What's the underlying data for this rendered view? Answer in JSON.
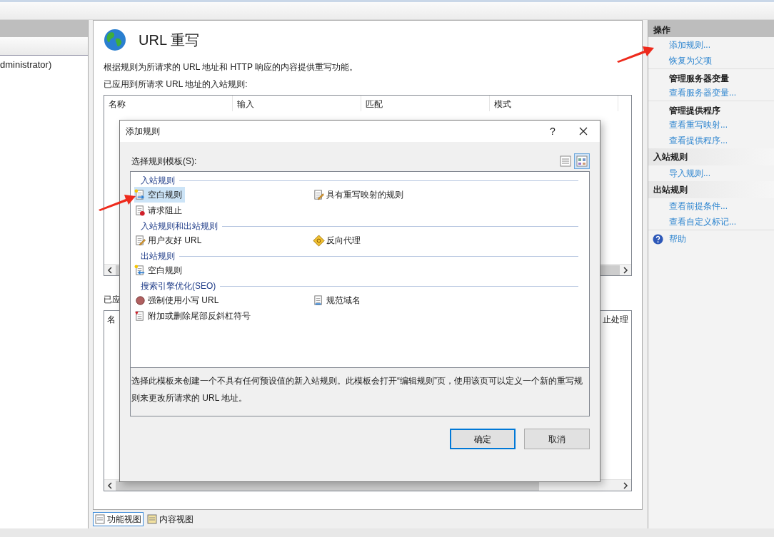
{
  "left_panel": {
    "tree_items": [
      "dministrator)"
    ]
  },
  "feature": {
    "title": "URL 重写",
    "description": "根据规则为所请求的 URL 地址和 HTTP 响应的内容提供重写功能。",
    "inbound_label": "已应用到所请求 URL 地址的入站规则:",
    "inbound_table": {
      "columns": [
        "名称",
        "输入",
        "匹配",
        "模式"
      ]
    },
    "outbound_label": "已应",
    "outbound_table": {
      "columns": [
        "名",
        "止处理"
      ]
    }
  },
  "view_tabs": [
    {
      "label": "功能视图",
      "selected": true
    },
    {
      "label": "内容视图",
      "selected": false
    }
  ],
  "actions": {
    "title": "操作",
    "items": [
      {
        "kind": "link",
        "label": "添加规则..."
      },
      {
        "kind": "link",
        "label": "恢复为父项"
      },
      {
        "kind": "heading",
        "label": "管理服务器变量"
      },
      {
        "kind": "link",
        "label": "查看服务器变量..."
      },
      {
        "kind": "heading",
        "label": "管理提供程序"
      },
      {
        "kind": "link",
        "label": "查看重写映射..."
      },
      {
        "kind": "link",
        "label": "查看提供程序..."
      },
      {
        "kind": "section",
        "label": "入站规则"
      },
      {
        "kind": "link",
        "label": "导入规则..."
      },
      {
        "kind": "section",
        "label": "出站规则"
      },
      {
        "kind": "link",
        "label": "查看前提条件..."
      },
      {
        "kind": "link",
        "label": "查看自定义标记..."
      },
      {
        "kind": "help",
        "label": "帮助"
      }
    ]
  },
  "dialog": {
    "title": "添加规则",
    "help": "?",
    "template_label": "选择规则模板(S):",
    "view_modes": [
      {
        "kind": "list",
        "selected": false
      },
      {
        "kind": "tiles",
        "selected": true
      }
    ],
    "groups": [
      {
        "title": "入站规则",
        "items": [
          {
            "kind": "new-inbound",
            "label": "空白规则",
            "selected": true
          },
          {
            "kind": "edit",
            "label": "具有重写映射的规则",
            "selected": false
          },
          {
            "kind": "block",
            "label": "请求阻止",
            "selected": false
          }
        ]
      },
      {
        "title": "入站规则和出站规则",
        "items": [
          {
            "kind": "edit",
            "label": "用户友好 URL",
            "selected": false
          },
          {
            "kind": "proxy",
            "label": "反向代理",
            "selected": false
          }
        ]
      },
      {
        "title": "出站规则",
        "items": [
          {
            "kind": "new-outbound",
            "label": "空白规则",
            "selected": false
          }
        ]
      },
      {
        "title": "搜索引擎优化(SEO)",
        "items": [
          {
            "kind": "lowercase",
            "label": "强制使用小写 URL",
            "selected": false
          },
          {
            "kind": "document",
            "label": "规范域名",
            "selected": false
          },
          {
            "kind": "slash",
            "label": "附加或删除尾部反斜杠符号",
            "selected": false
          }
        ]
      }
    ],
    "description": "选择此模板来创建一个不具有任何预设值的新入站规则。此模板会打开“编辑规则”页，使用该页可以定义一个新的重写规则来更改所请求的 URL 地址。",
    "buttons": [
      {
        "label": "确定",
        "default": true
      },
      {
        "label": "取消",
        "default": false
      }
    ]
  }
}
